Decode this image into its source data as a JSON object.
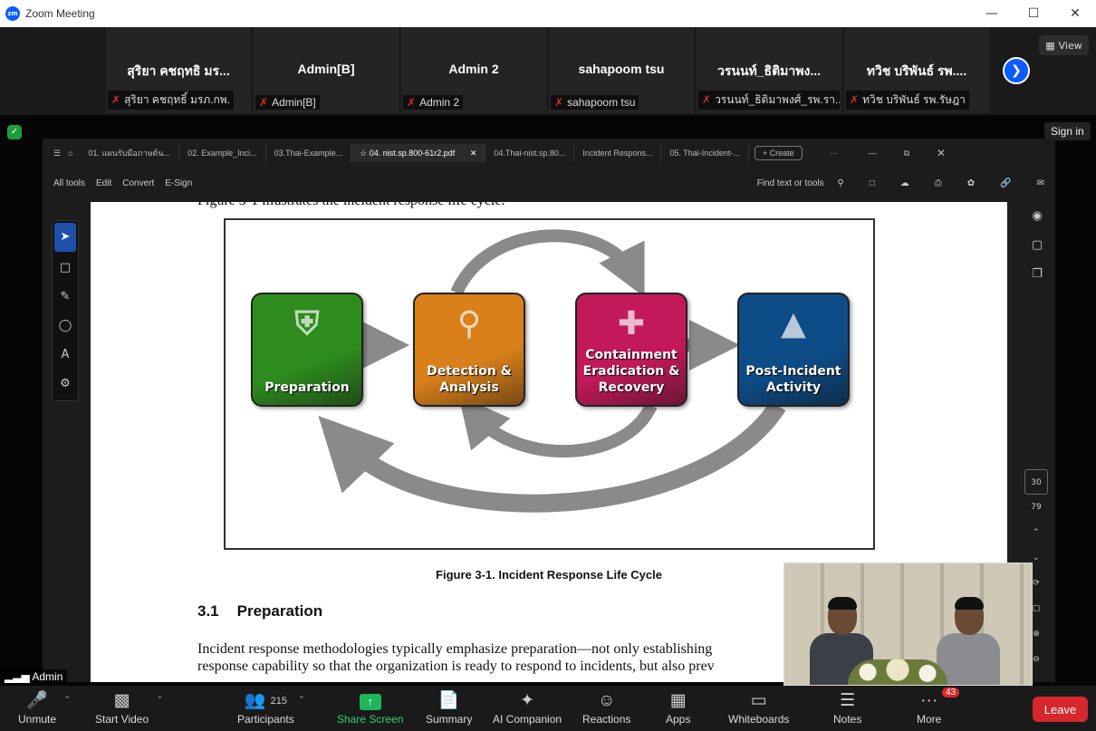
{
  "window": {
    "title": "Zoom Meeting",
    "logo": "zm"
  },
  "gallery": {
    "tiles": [
      {
        "name": "สุริยา คชฤทธิ มร...",
        "label": "สุริยา คชฤทธิ์ มรภ.กพ."
      },
      {
        "name": "Admin[B]",
        "label": "Admin[B]"
      },
      {
        "name": "Admin 2",
        "label": "Admin 2"
      },
      {
        "name": "sahapoom tsu",
        "label": "sahapoom tsu"
      },
      {
        "name": "วรนนท์_ธิติมาพง...",
        "label": "วรนนท์_ธิติมาพงศ์_รพ.รา..."
      },
      {
        "name": "ทวิช บริพันธ์ รพ....",
        "label": "ทวิช บริพันธ์ รพ.รัษฎา"
      }
    ],
    "view_label": "View"
  },
  "share": {
    "sign_in": "Sign in",
    "presenter_tag": "Admin",
    "pdf": {
      "tabs": [
        "01. แผนรับมือภาษต้น...",
        "02. Example_Inci...",
        "03.Thai-Example...",
        "04. nist.sp.800-61r2.pdf",
        "04.Thai-nist.sp.80...",
        "Incident Respons...",
        "05. Thai-Incident-..."
      ],
      "active_tab": 3,
      "create_label": "Create",
      "menu": [
        "All tools",
        "Edit",
        "Convert",
        "E-Sign"
      ],
      "find_label": "Find text or tools",
      "page_current": "30",
      "page_total": "79",
      "top_line": "Figure 3-1 illustrates the incident response life cycle.",
      "stages": [
        {
          "label": "Preparation",
          "color": "#2e8b1e"
        },
        {
          "label": "Detection & Analysis",
          "color": "#d9801a"
        },
        {
          "label": "Containment Eradication & Recovery",
          "color": "#c2195a"
        },
        {
          "label": "Post-Incident Activity",
          "color": "#0d4c86"
        }
      ],
      "caption": "Figure 3-1. Incident Response Life Cycle",
      "section_num": "3.1",
      "section_title": "Preparation",
      "paragraph": [
        "Incident response methodologies typically emphasize preparation—not only establishing",
        "response capability so that the organization is ready to respond to incidents, but also prev"
      ]
    }
  },
  "toolbar": {
    "unmute": "Unmute",
    "start_video": "Start Video",
    "participants": "Participants",
    "participant_count": "215",
    "share_screen": "Share Screen",
    "summary": "Summary",
    "ai_companion": "AI Companion",
    "reactions": "Reactions",
    "apps": "Apps",
    "whiteboards": "Whiteboards",
    "notes": "Notes",
    "more": "More",
    "more_badge": "43",
    "leave": "Leave"
  }
}
